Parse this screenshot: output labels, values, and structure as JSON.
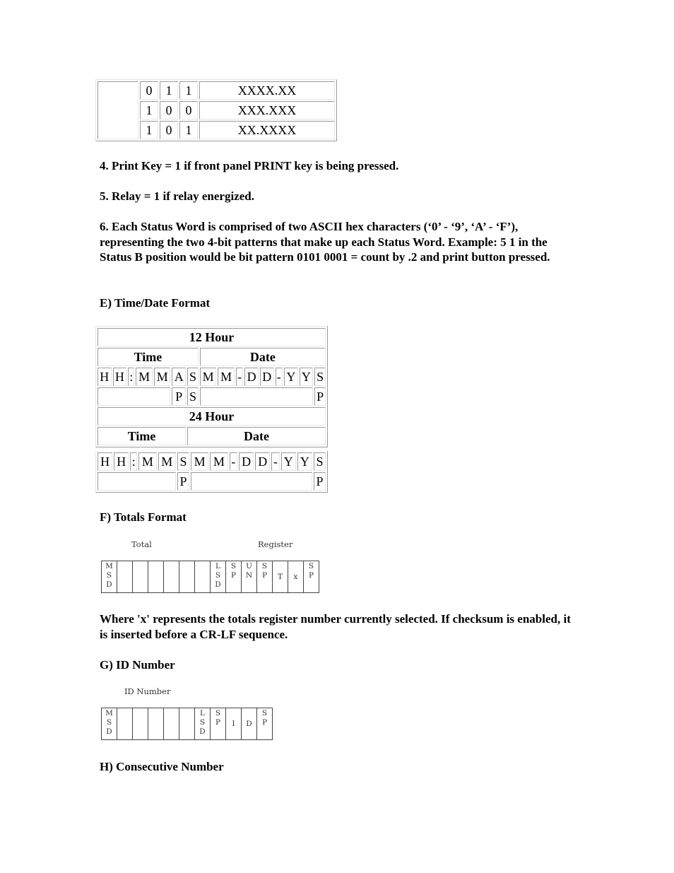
{
  "decimal_point_table": {
    "rows": [
      {
        "bits": [
          "0",
          "1",
          "1"
        ],
        "format": "XXXX.XX"
      },
      {
        "bits": [
          "1",
          "0",
          "0"
        ],
        "format": "XXX.XXX"
      },
      {
        "bits": [
          "1",
          "0",
          "1"
        ],
        "format": "XX.XXXX"
      }
    ]
  },
  "notes": {
    "note4": "4. Print Key = 1 if front panel PRINT key is being pressed.",
    "note5": "5. Relay = 1 if relay energized.",
    "note6": "6. Each Status Word is comprised of two ASCII hex characters (‘0’ - ‘9’, ‘A’ - ‘F’), representing the two 4-bit patterns that make up each Status Word. Example: 5 1 in the Status B position would be bit pattern 0101 0001 = count by .2 and print button pressed."
  },
  "sections": {
    "time_date": "E) Time/Date Format",
    "totals": "F) Totals Format",
    "id_number": "G) ID Number",
    "consecutive": "H) Consecutive Number"
  },
  "time_date_table": {
    "twelve_hour": {
      "title": "12 Hour",
      "time_label": "Time",
      "date_label": "Date",
      "time_chars": [
        "H",
        "H",
        ":",
        "M",
        "M",
        "A",
        "S"
      ],
      "date_chars": [
        "M",
        "M",
        "-",
        "D",
        "D",
        "-",
        "Y",
        "Y",
        "S"
      ],
      "row2_time": [
        "P",
        "S"
      ],
      "row2_date": [
        "P"
      ]
    },
    "twenty_four_hour": {
      "title": "24 Hour",
      "time_label": "Time",
      "date_label": "Date",
      "time_chars": [
        "H",
        "H",
        ":",
        "M",
        "M",
        "S"
      ],
      "date_chars": [
        "M",
        "M",
        "-",
        "D",
        "D",
        "-",
        "Y",
        "Y",
        "S"
      ],
      "row2_time": [
        "P"
      ],
      "row2_date": [
        "P"
      ]
    }
  },
  "totals_diagram": {
    "label_total": "Total",
    "label_register": "Register",
    "cells": [
      "M\nS\nD",
      "",
      "",
      "",
      "",
      "",
      "",
      "L\nS\nD",
      "S\nP",
      "U\nN",
      "S\nP",
      "T",
      "x",
      "S\nP"
    ]
  },
  "totals_note": "Where 'x' represents the totals register number currently selected. If checksum is enabled, it is inserted before a CR-LF sequence.",
  "id_diagram": {
    "label": "ID Number",
    "cells": [
      "M\nS\nD",
      "",
      "",
      "",
      "",
      "",
      "L\nS\nD",
      "S\nP",
      "I",
      "D",
      "S\nP"
    ]
  }
}
